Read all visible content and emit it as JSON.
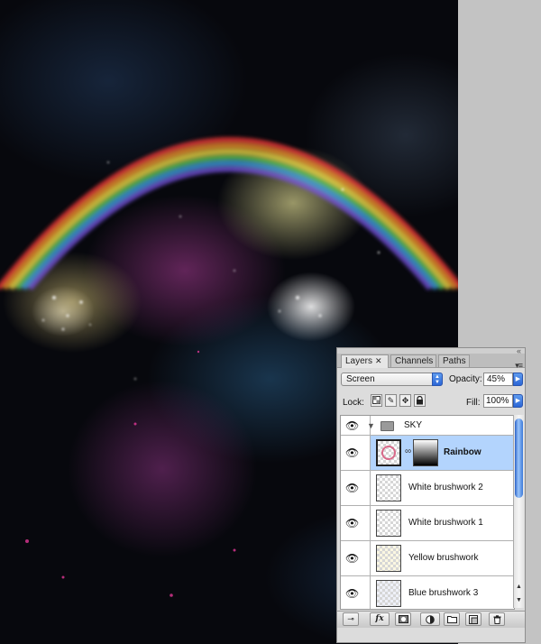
{
  "panel": {
    "tabs": [
      {
        "label": "Layers",
        "close": "✕",
        "active": true
      },
      {
        "label": "Channels",
        "active": false
      },
      {
        "label": "Paths",
        "active": false
      }
    ],
    "blend_mode": "Screen",
    "opacity_label": "Opacity:",
    "opacity_value": "45%",
    "lock_label": "Lock:",
    "fill_label": "Fill:",
    "fill_value": "100%",
    "group": {
      "name": "SKY"
    },
    "layers": [
      {
        "name": "Rainbow",
        "selected": true,
        "has_mask": true
      },
      {
        "name": "White brushwork 2",
        "selected": false
      },
      {
        "name": "White brushwork 1",
        "selected": false
      },
      {
        "name": "Yellow brushwork",
        "selected": false
      },
      {
        "name": "Blue brushwork 3",
        "selected": false
      }
    ],
    "toolbar": {
      "fx_label": "fx"
    }
  },
  "colors": {
    "selected_row": "#b3d4fd",
    "panel_bg": "#dcdcdc",
    "workspace_bg": "#c3c3c3",
    "accent_blue": "#2b66d6"
  },
  "icons": [
    "eye-icon",
    "folder-icon",
    "chain-link-icon",
    "lock-icon",
    "brush-icon",
    "move-icon",
    "trash-icon"
  ]
}
